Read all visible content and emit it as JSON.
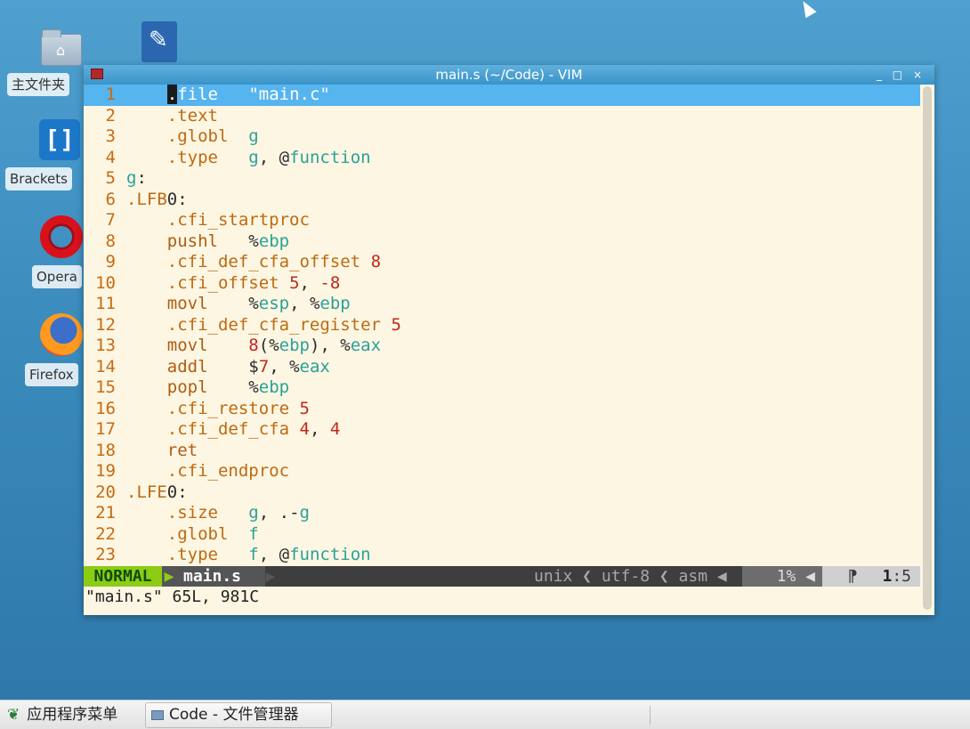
{
  "desktop": {
    "icons": [
      {
        "label": "主文件夹",
        "icon": "home-folder-icon"
      },
      {
        "label": "Brackets",
        "icon": "brackets-icon"
      },
      {
        "label": "Opera",
        "icon": "opera-icon"
      },
      {
        "label": "Firefox",
        "icon": "firefox-icon"
      },
      {
        "label": "",
        "icon": "text-editor-icon"
      }
    ]
  },
  "window": {
    "title": "main.s (~/Code) - VIM",
    "controls": {
      "minimize": "_",
      "maximize": "□",
      "close": "×"
    }
  },
  "editor": {
    "lines": [
      [
        {
          "t": "    "
        },
        {
          "t": ".",
          "c": "cur"
        },
        {
          "t": "file",
          "c": "w"
        },
        {
          "t": "   "
        },
        {
          "t": "\"main.c\"",
          "c": "w"
        }
      ],
      [
        {
          "t": "    "
        },
        {
          "t": ".text",
          "c": "d"
        }
      ],
      [
        {
          "t": "    "
        },
        {
          "t": ".globl",
          "c": "d"
        },
        {
          "t": "  "
        },
        {
          "t": "g",
          "c": "s"
        }
      ],
      [
        {
          "t": "    "
        },
        {
          "t": ".type",
          "c": "d"
        },
        {
          "t": "   "
        },
        {
          "t": "g",
          "c": "s"
        },
        {
          "t": ", ",
          "c": "p"
        },
        {
          "t": "@",
          "c": "p"
        },
        {
          "t": "function",
          "c": "s"
        }
      ],
      [
        {
          "t": "g",
          "c": "l"
        },
        {
          "t": ":",
          "c": "p"
        }
      ],
      [
        {
          "t": ".LFB",
          "c": "d"
        },
        {
          "t": "0:",
          "c": "p"
        }
      ],
      [
        {
          "t": "    "
        },
        {
          "t": ".cfi_startproc",
          "c": "d"
        }
      ],
      [
        {
          "t": "    "
        },
        {
          "t": "pushl",
          "c": "k"
        },
        {
          "t": "   "
        },
        {
          "t": "%",
          "c": "p"
        },
        {
          "t": "ebp",
          "c": "r"
        }
      ],
      [
        {
          "t": "    "
        },
        {
          "t": ".cfi_def_cfa_offset",
          "c": "d"
        },
        {
          "t": " "
        },
        {
          "t": "8",
          "c": "n"
        }
      ],
      [
        {
          "t": "    "
        },
        {
          "t": ".cfi_offset",
          "c": "d"
        },
        {
          "t": " "
        },
        {
          "t": "5",
          "c": "n"
        },
        {
          "t": ", ",
          "c": "p"
        },
        {
          "t": "-8",
          "c": "n"
        }
      ],
      [
        {
          "t": "    "
        },
        {
          "t": "movl",
          "c": "k"
        },
        {
          "t": "    "
        },
        {
          "t": "%",
          "c": "p"
        },
        {
          "t": "esp",
          "c": "r"
        },
        {
          "t": ", ",
          "c": "p"
        },
        {
          "t": "%",
          "c": "p"
        },
        {
          "t": "ebp",
          "c": "r"
        }
      ],
      [
        {
          "t": "    "
        },
        {
          "t": ".cfi_def_cfa_register",
          "c": "d"
        },
        {
          "t": " "
        },
        {
          "t": "5",
          "c": "n"
        }
      ],
      [
        {
          "t": "    "
        },
        {
          "t": "movl",
          "c": "k"
        },
        {
          "t": "    "
        },
        {
          "t": "8",
          "c": "n"
        },
        {
          "t": "(%",
          "c": "p"
        },
        {
          "t": "ebp",
          "c": "r"
        },
        {
          "t": "), %",
          "c": "p"
        },
        {
          "t": "eax",
          "c": "r"
        }
      ],
      [
        {
          "t": "    "
        },
        {
          "t": "addl",
          "c": "k"
        },
        {
          "t": "    "
        },
        {
          "t": "$",
          "c": "p"
        },
        {
          "t": "7",
          "c": "n"
        },
        {
          "t": ", %",
          "c": "p"
        },
        {
          "t": "eax",
          "c": "r"
        }
      ],
      [
        {
          "t": "    "
        },
        {
          "t": "popl",
          "c": "k"
        },
        {
          "t": "    "
        },
        {
          "t": "%",
          "c": "p"
        },
        {
          "t": "ebp",
          "c": "r"
        }
      ],
      [
        {
          "t": "    "
        },
        {
          "t": ".cfi_restore",
          "c": "d"
        },
        {
          "t": " "
        },
        {
          "t": "5",
          "c": "n"
        }
      ],
      [
        {
          "t": "    "
        },
        {
          "t": ".cfi_def_cfa",
          "c": "d"
        },
        {
          "t": " "
        },
        {
          "t": "4",
          "c": "n"
        },
        {
          "t": ", ",
          "c": "p"
        },
        {
          "t": "4",
          "c": "n"
        }
      ],
      [
        {
          "t": "    "
        },
        {
          "t": "ret",
          "c": "k"
        }
      ],
      [
        {
          "t": "    "
        },
        {
          "t": ".cfi_endproc",
          "c": "d"
        }
      ],
      [
        {
          "t": ".LFE",
          "c": "d"
        },
        {
          "t": "0:",
          "c": "p"
        }
      ],
      [
        {
          "t": "    "
        },
        {
          "t": ".size",
          "c": "d"
        },
        {
          "t": "   "
        },
        {
          "t": "g",
          "c": "s"
        },
        {
          "t": ", ",
          "c": "p"
        },
        {
          "t": ".-",
          "c": "p"
        },
        {
          "t": "g",
          "c": "s"
        }
      ],
      [
        {
          "t": "    "
        },
        {
          "t": ".globl",
          "c": "d"
        },
        {
          "t": "  "
        },
        {
          "t": "f",
          "c": "s"
        }
      ],
      [
        {
          "t": "    "
        },
        {
          "t": ".type",
          "c": "d"
        },
        {
          "t": "   "
        },
        {
          "t": "f",
          "c": "s"
        },
        {
          "t": ", ",
          "c": "p"
        },
        {
          "t": "@",
          "c": "p"
        },
        {
          "t": "function",
          "c": "s"
        }
      ]
    ]
  },
  "statusline": {
    "mode": "NORMAL",
    "arrow": "▶",
    "file": "main.s",
    "info": "unix ❮ utf-8 ❮ asm ◀",
    "percent": "1% ◀",
    "pos_glyph": "⁋",
    "line": "1",
    "col": ":5"
  },
  "cmdline": "\"main.s\" 65L, 981C",
  "taskbar": {
    "menu_label": "应用程序菜单",
    "task_label": "Code - 文件管理器"
  },
  "colors": {
    "editor_bg": "#fdf6e3",
    "current_line": "#56b4ef",
    "mode_bg": "#8ccc14"
  }
}
